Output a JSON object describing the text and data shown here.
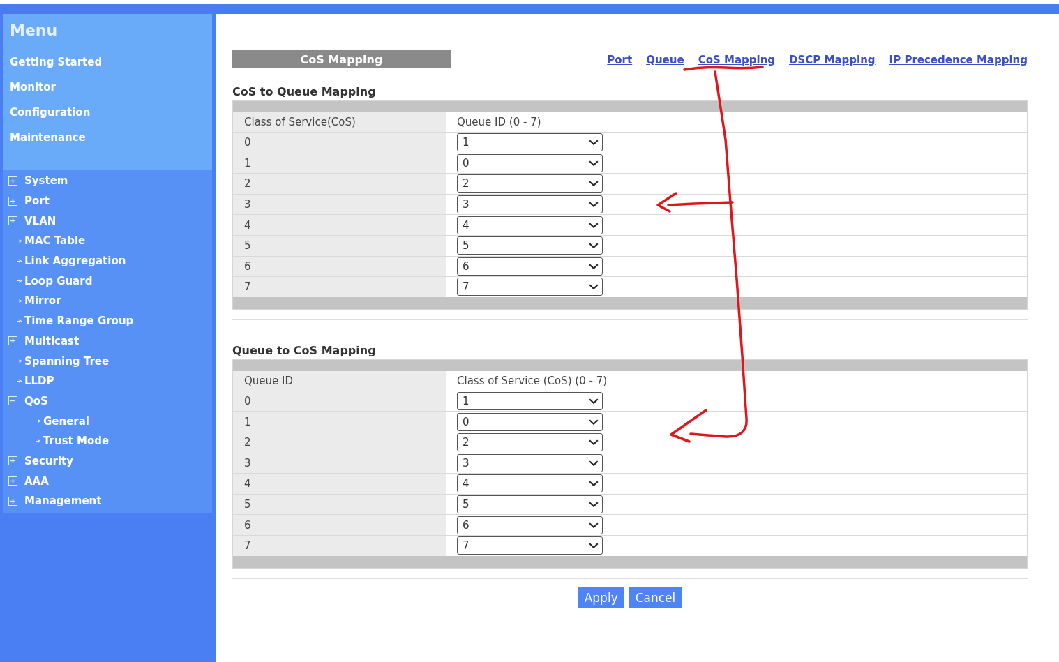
{
  "sidebar": {
    "menu": {
      "title": "Menu",
      "items": [
        "Getting Started",
        "Monitor",
        "Configuration",
        "Maintenance"
      ]
    },
    "tree": [
      {
        "label": "System",
        "kind": "folder",
        "expanded": false
      },
      {
        "label": "Port",
        "kind": "folder",
        "expanded": false
      },
      {
        "label": "VLAN",
        "kind": "folder",
        "expanded": false
      },
      {
        "label": "MAC Table",
        "kind": "page"
      },
      {
        "label": "Link Aggregation",
        "kind": "page"
      },
      {
        "label": "Loop Guard",
        "kind": "page"
      },
      {
        "label": "Mirror",
        "kind": "page"
      },
      {
        "label": "Time Range Group",
        "kind": "page"
      },
      {
        "label": "Multicast",
        "kind": "folder",
        "expanded": false
      },
      {
        "label": "Spanning Tree",
        "kind": "page"
      },
      {
        "label": "LLDP",
        "kind": "page"
      },
      {
        "label": "QoS",
        "kind": "folder",
        "expanded": true,
        "children": [
          {
            "label": "General",
            "kind": "page"
          },
          {
            "label": "Trust Mode",
            "kind": "page"
          }
        ]
      },
      {
        "label": "Security",
        "kind": "folder",
        "expanded": false
      },
      {
        "label": "AAA",
        "kind": "folder",
        "expanded": false
      },
      {
        "label": "Management",
        "kind": "folder",
        "expanded": false
      }
    ]
  },
  "page_title": "CoS Mapping",
  "links": [
    "Port",
    "Queue",
    "CoS Mapping",
    "DSCP Mapping",
    "IP Precedence Mapping"
  ],
  "sections": [
    {
      "title": "CoS to Queue Mapping",
      "columns": [
        "Class of Service(CoS)",
        "Queue ID (0 - 7)"
      ],
      "rows": [
        {
          "label": "0",
          "value": "1"
        },
        {
          "label": "1",
          "value": "0"
        },
        {
          "label": "2",
          "value": "2"
        },
        {
          "label": "3",
          "value": "3"
        },
        {
          "label": "4",
          "value": "4"
        },
        {
          "label": "5",
          "value": "5"
        },
        {
          "label": "6",
          "value": "6"
        },
        {
          "label": "7",
          "value": "7"
        }
      ]
    },
    {
      "title": "Queue to CoS Mapping",
      "columns": [
        "Queue ID",
        "Class of Service (CoS) (0 - 7)"
      ],
      "rows": [
        {
          "label": "0",
          "value": "1"
        },
        {
          "label": "1",
          "value": "0"
        },
        {
          "label": "2",
          "value": "2"
        },
        {
          "label": "3",
          "value": "3"
        },
        {
          "label": "4",
          "value": "4"
        },
        {
          "label": "5",
          "value": "5"
        },
        {
          "label": "6",
          "value": "6"
        },
        {
          "label": "7",
          "value": "7"
        }
      ]
    }
  ],
  "buttons": [
    "Apply",
    "Cancel"
  ]
}
